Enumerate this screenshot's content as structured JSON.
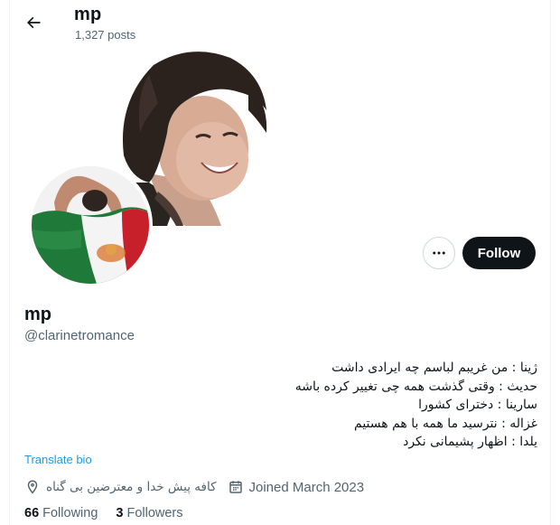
{
  "header": {
    "back_icon": "arrow-left-icon",
    "name": "mp",
    "posts": "1,327 posts"
  },
  "actions": {
    "more_icon": "more-horizontal-icon",
    "follow_label": "Follow"
  },
  "profile": {
    "name": "mp",
    "handle": "@clarinetromance",
    "bio_lines": [
      "ژینا : من غریبم لباسم چه ایرادی داشت",
      "حدیث : وقتی گذشت همه چی تغییر کرده باشه",
      "سارینا : دخترای کشورا",
      "غزاله : نترسید ما همه با هم هستیم",
      "یلدا : اظهار پشیمانی نکرد"
    ],
    "translate_label": "Translate bio",
    "location_icon": "location-pin-icon",
    "location": "کافه پیش خدا و معترضین بی گناه",
    "joined_icon": "calendar-icon",
    "joined": "Joined March 2023",
    "following_count": "66",
    "following_label": "Following",
    "followers_count": "3",
    "followers_label": "Followers"
  },
  "colors": {
    "text": "#0f1419",
    "secondary": "#536471",
    "link": "#1d9bf0",
    "button_dark": "#0f1419",
    "border": "#cfd9de"
  }
}
